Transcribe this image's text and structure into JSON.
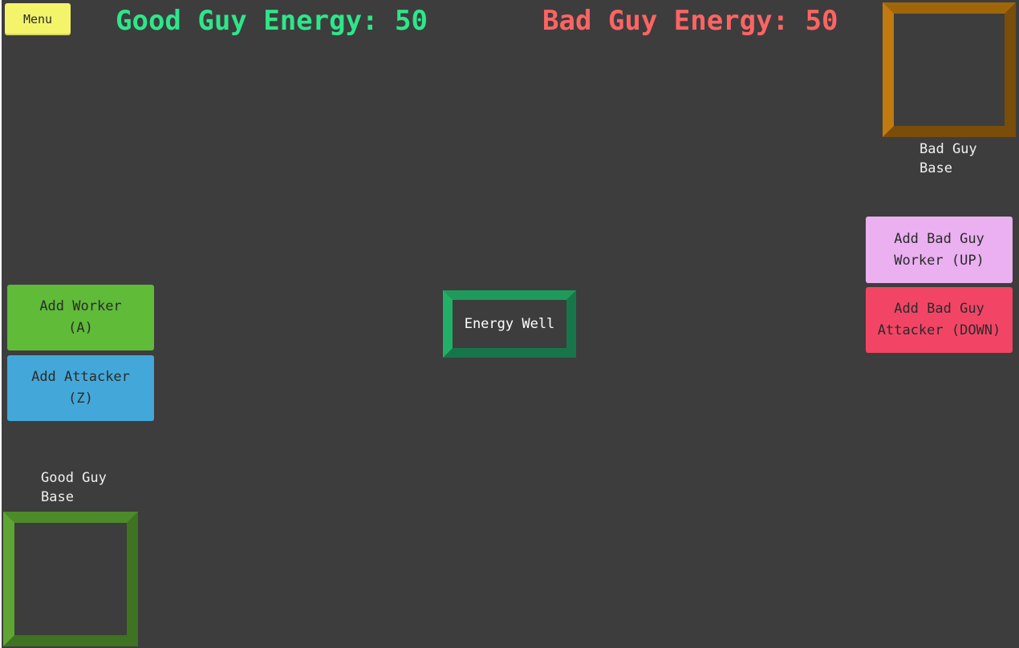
{
  "menu": {
    "label": "Menu"
  },
  "hud": {
    "good_energy": "Good Guy Energy: 50",
    "bad_energy": "Bad Guy Energy: 50"
  },
  "bad_base": {
    "label": "Bad Guy\nBase"
  },
  "good_base": {
    "label": "Good Guy\nBase"
  },
  "energy_well": {
    "label": "Energy Well"
  },
  "buttons": {
    "add_worker": "Add Worker\n(A)",
    "add_attacker": "Add Attacker\n(Z)",
    "add_bad_worker": "Add Bad Guy\nWorker (UP)",
    "add_bad_attacker": "Add Bad Guy\nAttacker (DOWN)"
  },
  "colors": {
    "background": "#3d3d3d",
    "good_energy_text": "#2ee68a",
    "bad_energy_text": "#ff6464",
    "menu_button": "#f4f46a",
    "add_worker_button": "#5fbb38",
    "add_attacker_button": "#43a8d9",
    "add_bad_worker_button": "#eab0f0",
    "add_bad_attacker_button": "#f24565",
    "bad_base_frame": "#a0660a",
    "good_base_frame": "#4d8a2a",
    "energy_well_frame": "#1e9a5a"
  }
}
